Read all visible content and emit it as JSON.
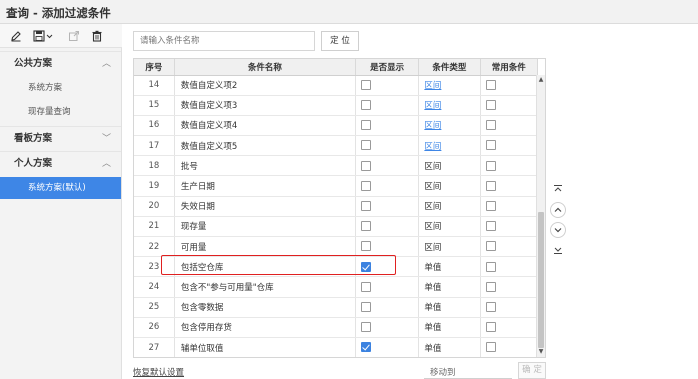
{
  "window": {
    "title": "查询 - 添加过滤条件"
  },
  "toolbar": {
    "icons": [
      "edit-icon",
      "save-icon",
      "export-icon",
      "delete-icon"
    ]
  },
  "sidebar": {
    "groups": [
      {
        "label": "公共方案",
        "chevron": "︿"
      },
      {
        "label": "看板方案",
        "chevron": "﹀"
      },
      {
        "label": "个人方案",
        "chevron": "︿"
      }
    ],
    "public_items": [
      "系统方案",
      "现存量查询"
    ],
    "personal_items": [
      "系统方案(默认)"
    ]
  },
  "search": {
    "placeholder": "请输入条件名称",
    "button": "定 位"
  },
  "table": {
    "headers": [
      "序号",
      "条件名称",
      "是否显示",
      "条件类型",
      "常用条件"
    ],
    "rows": [
      {
        "no": "14",
        "name": "数值自定义项2",
        "show": false,
        "type": "区间",
        "type_link": true,
        "fav": false
      },
      {
        "no": "15",
        "name": "数值自定义项3",
        "show": false,
        "type": "区间",
        "type_link": true,
        "fav": false
      },
      {
        "no": "16",
        "name": "数值自定义项4",
        "show": false,
        "type": "区间",
        "type_link": true,
        "fav": false
      },
      {
        "no": "17",
        "name": "数值自定义项5",
        "show": false,
        "type": "区间",
        "type_link": true,
        "fav": false
      },
      {
        "no": "18",
        "name": "批号",
        "show": false,
        "type": "区间",
        "type_link": false,
        "fav": false
      },
      {
        "no": "19",
        "name": "生产日期",
        "show": false,
        "type": "区间",
        "type_link": false,
        "fav": false
      },
      {
        "no": "20",
        "name": "失效日期",
        "show": false,
        "type": "区间",
        "type_link": false,
        "fav": false
      },
      {
        "no": "21",
        "name": "现存量",
        "show": false,
        "type": "区间",
        "type_link": false,
        "fav": false
      },
      {
        "no": "22",
        "name": "可用量",
        "show": false,
        "type": "区间",
        "type_link": false,
        "fav": false
      },
      {
        "no": "23",
        "name": "包括空仓库",
        "show": true,
        "type": "单值",
        "type_link": false,
        "fav": false
      },
      {
        "no": "24",
        "name": "包含不\"参与可用量\"仓库",
        "show": false,
        "type": "单值",
        "type_link": false,
        "fav": false
      },
      {
        "no": "25",
        "name": "包含零数据",
        "show": false,
        "type": "单值",
        "type_link": false,
        "fav": false
      },
      {
        "no": "26",
        "name": "包含停用存货",
        "show": false,
        "type": "单值",
        "type_link": false,
        "fav": false
      },
      {
        "no": "27",
        "name": "辅单位取值",
        "show": true,
        "type": "单值",
        "type_link": false,
        "fav": false
      }
    ]
  },
  "footer": {
    "reset": "恢复默认设置",
    "move_to": "移动到",
    "ok": "确 定"
  },
  "side_controls": [
    "move-top-icon",
    "move-up-icon",
    "move-down-icon",
    "move-bottom-icon"
  ],
  "colors": {
    "accent": "#3e86e6",
    "highlight": "#e02020"
  }
}
